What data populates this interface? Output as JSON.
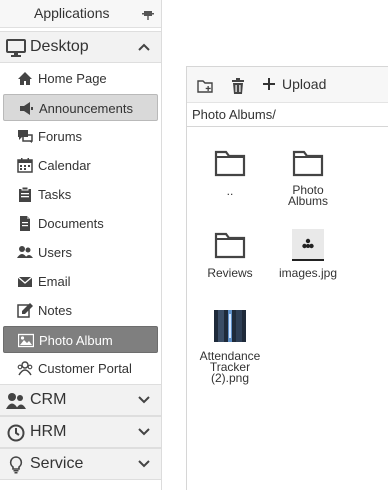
{
  "sidebar": {
    "header": {
      "title": "Applications",
      "pin_icon": "pin-icon"
    },
    "desktop": {
      "label": "Desktop",
      "icon": "monitor-icon",
      "expanded": true,
      "items": [
        {
          "label": "Home Page",
          "icon": "home-icon"
        },
        {
          "label": "Announcements",
          "icon": "megaphone-icon"
        },
        {
          "label": "Forums",
          "icon": "chat-bubbles-icon"
        },
        {
          "label": "Calendar",
          "icon": "calendar-icon"
        },
        {
          "label": "Tasks",
          "icon": "clipboard-icon"
        },
        {
          "label": "Documents",
          "icon": "document-icon"
        },
        {
          "label": "Users",
          "icon": "users-icon"
        },
        {
          "label": "Email",
          "icon": "envelope-icon"
        },
        {
          "label": "Notes",
          "icon": "edit-note-icon"
        },
        {
          "label": "Photo Album",
          "icon": "image-icon"
        },
        {
          "label": "Customer Portal",
          "icon": "customers-icon"
        }
      ]
    },
    "groups": [
      {
        "label": "CRM",
        "icon": "user-group-icon"
      },
      {
        "label": "HRM",
        "icon": "clock-icon"
      },
      {
        "label": "Service",
        "icon": "lightbulb-icon"
      }
    ]
  },
  "toolbar": {
    "upload_label": "Upload",
    "new_folder_icon": "new-folder-icon",
    "delete_icon": "trash-icon"
  },
  "path": "Photo Albums/",
  "files": [
    {
      "caption": "..",
      "kind": "folder"
    },
    {
      "caption": "Photo Albums",
      "kind": "folder"
    },
    {
      "caption": "Reviews",
      "kind": "folder"
    },
    {
      "caption": "images.jpg",
      "kind": "image"
    },
    {
      "caption": "Attendance Tracker (2).png",
      "kind": "image"
    }
  ]
}
